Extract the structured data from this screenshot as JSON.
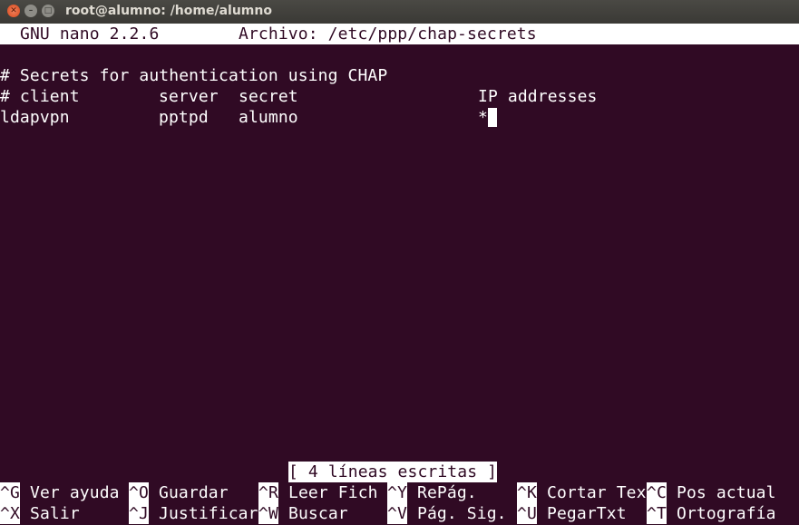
{
  "window": {
    "title": "root@alumno: /home/alumno",
    "buttons": [
      "close",
      "minimize",
      "maximize"
    ]
  },
  "header": {
    "app": "GNU nano 2.2.6",
    "file": "Archivo: /etc/ppp/chap-secrets"
  },
  "content": {
    "line1": "# Secrets for authentication using CHAP",
    "columns": {
      "c1": "# client",
      "c2": "server",
      "c3": "secret",
      "c4": "IP addresses"
    },
    "entry": {
      "client": "ldapvpn",
      "server": "pptpd",
      "secret": "alumno",
      "ip": "*"
    }
  },
  "status": "[ 4 líneas escritas ]",
  "shortcuts": [
    [
      {
        "key": "^G",
        "label": "Ver ayuda"
      },
      {
        "key": "^O",
        "label": "Guardar"
      },
      {
        "key": "^R",
        "label": "Leer Fich"
      },
      {
        "key": "^Y",
        "label": "RePág."
      },
      {
        "key": "^K",
        "label": "Cortar Tex"
      },
      {
        "key": "^C",
        "label": "Pos actual"
      }
    ],
    [
      {
        "key": "^X",
        "label": "Salir"
      },
      {
        "key": "^J",
        "label": "Justificar"
      },
      {
        "key": "^W",
        "label": "Buscar"
      },
      {
        "key": "^V",
        "label": "Pág. Sig."
      },
      {
        "key": "^U",
        "label": "PegarTxt"
      },
      {
        "key": "^T",
        "label": "Ortografía"
      }
    ]
  ]
}
